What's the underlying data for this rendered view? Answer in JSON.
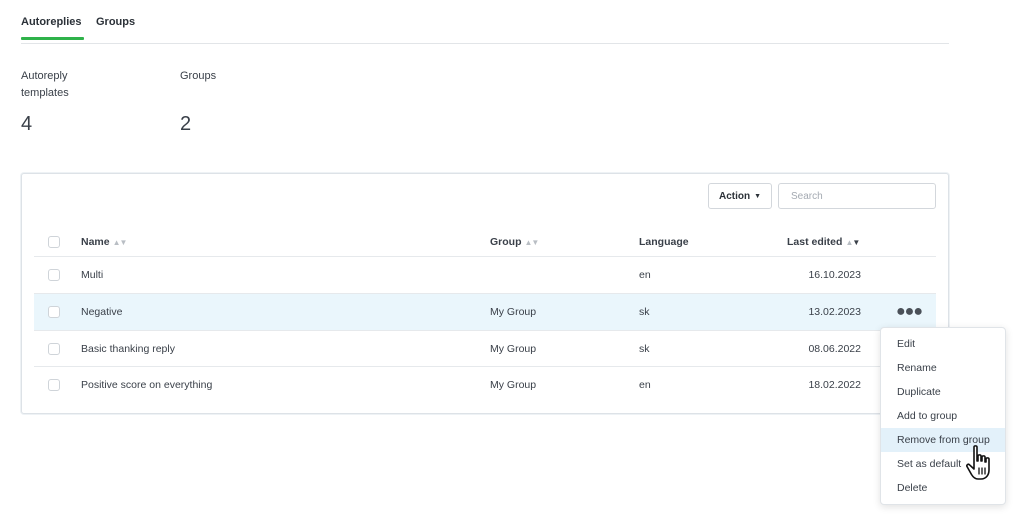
{
  "tabs": [
    {
      "label": "Autoreplies",
      "active": true
    },
    {
      "label": "Groups",
      "active": false
    }
  ],
  "stats": [
    {
      "label_line1": "Autoreply",
      "label_line2": "templates",
      "value": "4"
    },
    {
      "label_line1": "Groups",
      "label_line2": "",
      "value": "2"
    }
  ],
  "toolbar": {
    "action_label": "Action",
    "search_placeholder": "Search"
  },
  "table": {
    "columns": {
      "name": "Name",
      "group": "Group",
      "language": "Language",
      "last_edited": "Last edited"
    },
    "rows": [
      {
        "name": "Multi",
        "group": "",
        "language": "en",
        "last_edited": "16.10.2023"
      },
      {
        "name": "Negative",
        "group": "My Group",
        "language": "sk",
        "last_edited": "13.02.2023"
      },
      {
        "name": "Basic thanking reply",
        "group": "My Group",
        "language": "sk",
        "last_edited": "08.06.2022"
      },
      {
        "name": "Positive score on everything",
        "group": "My Group",
        "language": "en",
        "last_edited": "18.02.2022"
      }
    ]
  },
  "context_menu": {
    "items": [
      "Edit",
      "Rename",
      "Duplicate",
      "Add to group",
      "Remove from group",
      "Set as default",
      "Delete"
    ],
    "highlighted": "Remove from group"
  },
  "colors": {
    "accent": "#2fb24a",
    "row_highlight": "#eaf6fc",
    "menu_highlight": "#e3f1fa"
  },
  "icons": {
    "row_menu": "more-horizontal-icon",
    "sort": "sort-arrows-icon",
    "caret": "caret-down-icon",
    "cursor": "hand-pointer-icon"
  }
}
